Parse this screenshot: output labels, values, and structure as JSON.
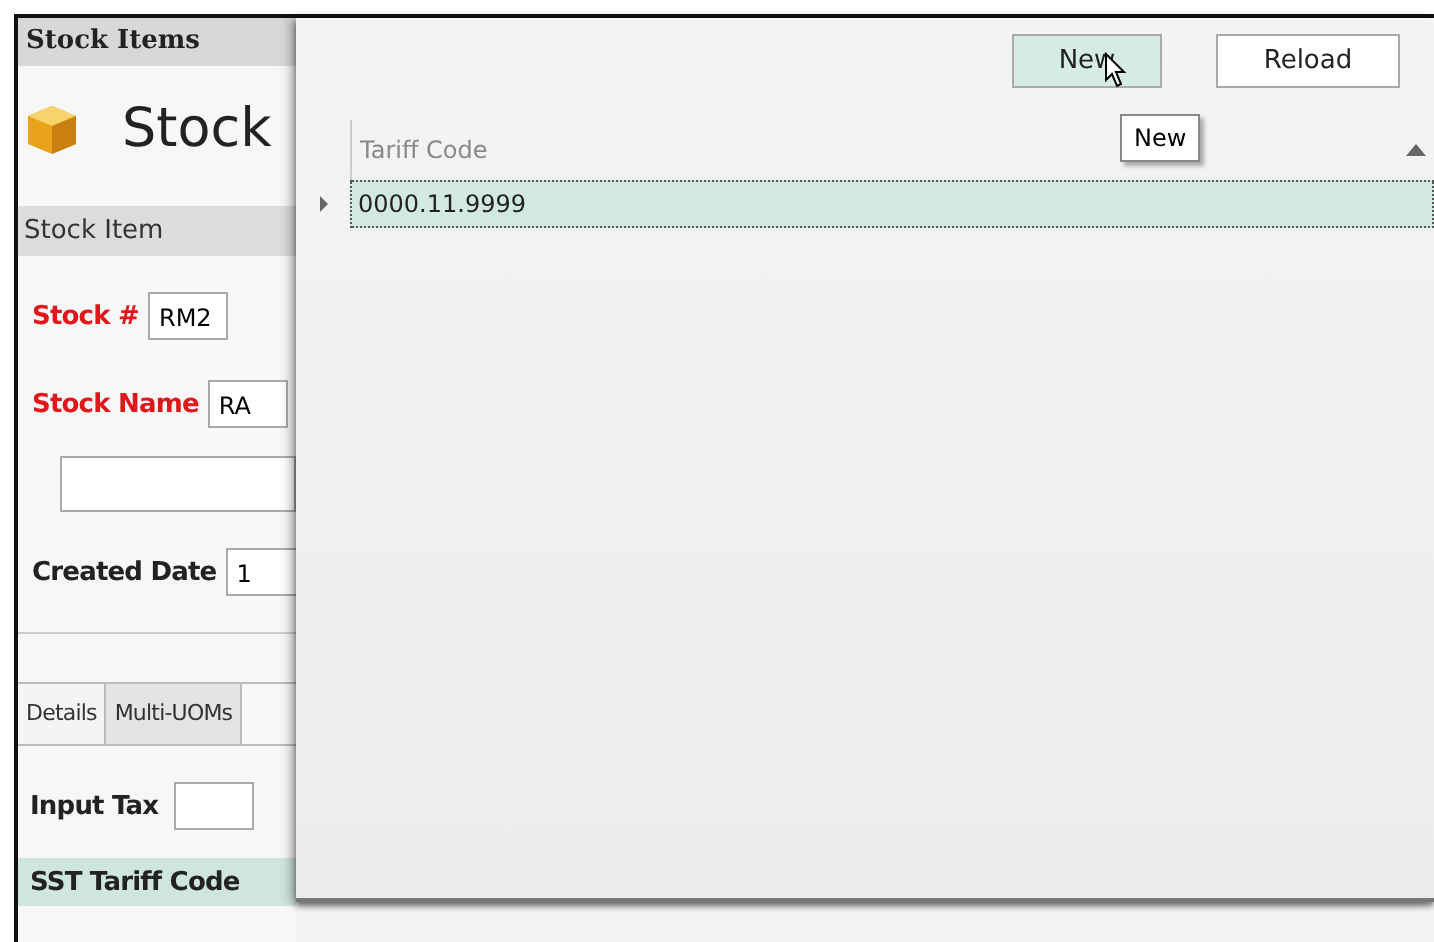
{
  "stock_form": {
    "title": "Stock Items",
    "heading": "Stock",
    "section": "Stock Item",
    "fields": [
      {
        "kind": "labeled",
        "label": "Stock #",
        "value": "RM2",
        "required": true
      },
      {
        "kind": "labeled",
        "label": "Stock Name",
        "value": "RA",
        "required": true
      },
      {
        "kind": "blank"
      },
      {
        "kind": "labeled",
        "label": "Created Date",
        "value": "1",
        "required": false
      }
    ],
    "tabs": [
      {
        "label": "Details",
        "selected": true
      },
      {
        "label": "Multi-UOMs",
        "selected": false
      }
    ],
    "tax_fields": [
      {
        "label": "Input Tax",
        "has_field": true,
        "selected": false
      },
      {
        "label": "SST Tariff Code",
        "selected": true
      }
    ]
  },
  "popup": {
    "buttons": [
      {
        "label": "New",
        "hovered": true
      },
      {
        "label": "Reload",
        "hovered": false
      }
    ],
    "tooltip": "New",
    "grid": {
      "columns": [
        {
          "label": "Tariff Code",
          "sorted_ascending": true
        }
      ],
      "rows": [
        {
          "cells": [
            "0000.11.9999"
          ],
          "selected": true
        }
      ]
    }
  }
}
